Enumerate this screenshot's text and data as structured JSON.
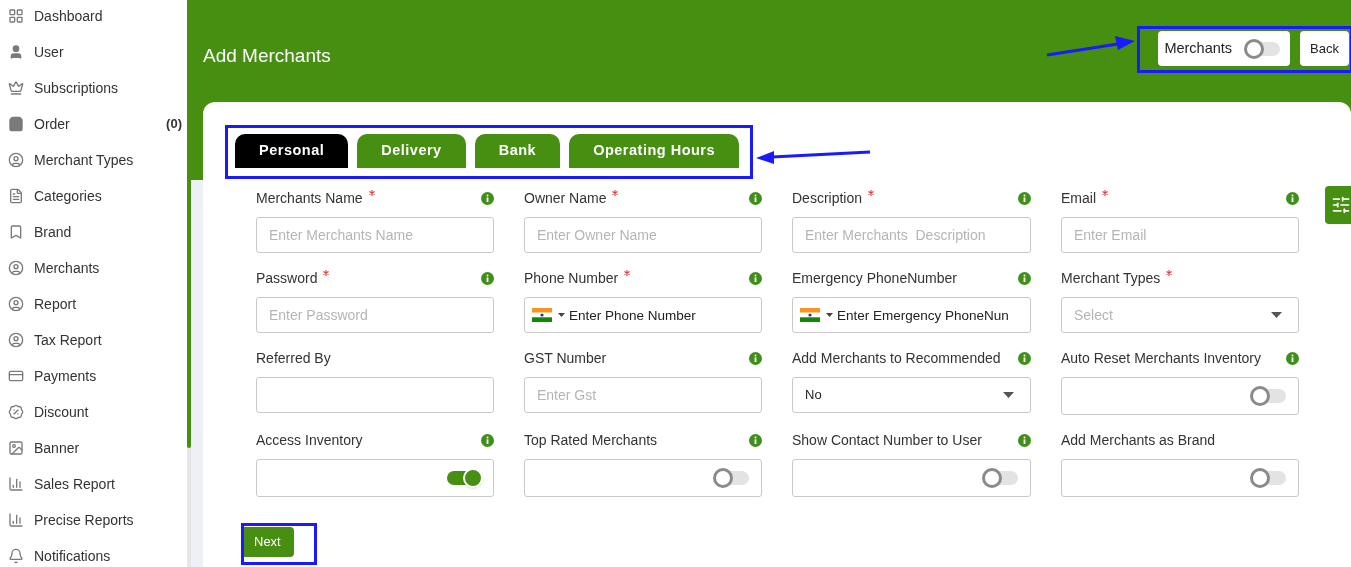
{
  "sidebar": {
    "items": [
      {
        "label": "Dashboard"
      },
      {
        "label": "User"
      },
      {
        "label": "Subscriptions"
      },
      {
        "label": "Order",
        "count": "(0)"
      },
      {
        "label": "Merchant Types"
      },
      {
        "label": "Categories"
      },
      {
        "label": "Brand"
      },
      {
        "label": "Merchants"
      },
      {
        "label": "Report"
      },
      {
        "label": "Tax Report"
      },
      {
        "label": "Payments"
      },
      {
        "label": "Discount"
      },
      {
        "label": "Banner"
      },
      {
        "label": "Sales Report"
      },
      {
        "label": "Precise Reports"
      },
      {
        "label": "Notifications"
      }
    ]
  },
  "header": {
    "title": "Add Merchants",
    "toggle": {
      "label": "Merchants",
      "on": false
    },
    "back_button": "Back"
  },
  "tabs": [
    {
      "label": "Personal",
      "selected": true
    },
    {
      "label": "Delivery",
      "selected": false
    },
    {
      "label": "Bank",
      "selected": false
    },
    {
      "label": "Operating Hours",
      "selected": false
    }
  ],
  "fields": [
    {
      "label": "Merchants Name",
      "required": true,
      "info": true,
      "kind": "text",
      "placeholder": "Enter Merchants Name"
    },
    {
      "label": "Owner Name",
      "required": true,
      "info": true,
      "kind": "text",
      "placeholder": "Enter Owner Name"
    },
    {
      "label": "Description",
      "required": true,
      "info": true,
      "kind": "text",
      "placeholder": "Enter Merchants  Description"
    },
    {
      "label": "Email",
      "required": true,
      "info": true,
      "kind": "text",
      "placeholder": "Enter Email"
    },
    {
      "label": "Password",
      "required": true,
      "info": true,
      "kind": "text",
      "placeholder": "Enter Password"
    },
    {
      "label": "Phone Number",
      "required": true,
      "info": true,
      "kind": "phone",
      "placeholder": "Enter Phone Number"
    },
    {
      "label": "Emergency PhoneNumber",
      "required": false,
      "info": true,
      "kind": "phone",
      "placeholder": "Enter Emergency PhoneNun"
    },
    {
      "label": "Merchant Types",
      "required": true,
      "info": false,
      "kind": "select",
      "placeholder": "Select"
    },
    {
      "label": "Referred By",
      "required": false,
      "info": false,
      "kind": "text"
    },
    {
      "label": "GST Number",
      "required": false,
      "info": true,
      "kind": "text",
      "placeholder": "Enter Gst"
    },
    {
      "label": "Add Merchants to Recommended",
      "required": false,
      "info": true,
      "kind": "select",
      "value": "No"
    },
    {
      "label": "Auto Reset Merchants Inventory",
      "required": false,
      "info": true,
      "kind": "toggle",
      "on": false
    },
    {
      "label": "Access Inventory",
      "required": false,
      "info": true,
      "kind": "toggle",
      "on": true
    },
    {
      "label": "Top Rated Merchants",
      "required": false,
      "info": true,
      "kind": "toggle",
      "on": false
    },
    {
      "label": "Show Contact Number to User",
      "required": false,
      "info": true,
      "kind": "toggle",
      "on": false
    },
    {
      "label": "Add Merchants as Brand",
      "required": false,
      "info": false,
      "kind": "toggle",
      "on": false
    }
  ],
  "next_button": "Next"
}
